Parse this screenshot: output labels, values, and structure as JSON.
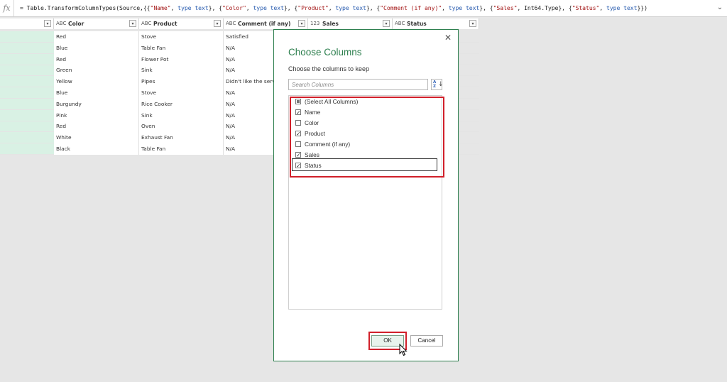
{
  "formula_bar": {
    "fx_label": "fx",
    "formula_prefix": "= Table.TransformColumnTypes(Source,{{",
    "formula_parts": [
      {
        "t": "st",
        "v": "\"Name\""
      },
      {
        "t": "p",
        "v": ", "
      },
      {
        "t": "kw",
        "v": "type text"
      },
      {
        "t": "p",
        "v": "}, {"
      },
      {
        "t": "st",
        "v": "\"Color\""
      },
      {
        "t": "p",
        "v": ", "
      },
      {
        "t": "kw",
        "v": "type text"
      },
      {
        "t": "p",
        "v": "}, {"
      },
      {
        "t": "st",
        "v": "\"Product\""
      },
      {
        "t": "p",
        "v": ", "
      },
      {
        "t": "kw",
        "v": "type text"
      },
      {
        "t": "p",
        "v": "}, {"
      },
      {
        "t": "st",
        "v": "\"Comment (if any)\""
      },
      {
        "t": "p",
        "v": ", "
      },
      {
        "t": "kw",
        "v": "type text"
      },
      {
        "t": "p",
        "v": "}, {"
      },
      {
        "t": "st",
        "v": "\"Sales\""
      },
      {
        "t": "p",
        "v": ", Int64.Type}, {"
      },
      {
        "t": "st",
        "v": "\"Status\""
      },
      {
        "t": "p",
        "v": ", "
      },
      {
        "t": "kw",
        "v": "type text"
      },
      {
        "t": "p",
        "v": "}})"
      }
    ],
    "expand_glyph": "⌄"
  },
  "grid": {
    "columns": [
      {
        "type": "",
        "label": ""
      },
      {
        "type": "ABC",
        "label": "Color"
      },
      {
        "type": "ABC",
        "label": "Product"
      },
      {
        "type": "ABC",
        "label": "Comment (if any)"
      },
      {
        "type": "123",
        "label": "Sales"
      },
      {
        "type": "ABC",
        "label": "Status"
      }
    ],
    "rows": [
      [
        "Red",
        "Stove",
        "Satisfied"
      ],
      [
        "Blue",
        "Table Fan",
        "N/A"
      ],
      [
        "Red",
        "Flower Pot",
        "N/A"
      ],
      [
        "Green",
        "Sink",
        "N/A"
      ],
      [
        "Yellow",
        "Pipes",
        "Didn't like the serv"
      ],
      [
        "Blue",
        "Stove",
        "N/A"
      ],
      [
        "Burgundy",
        "Rice Cooker",
        "N/A"
      ],
      [
        "Pink",
        "Sink",
        "N/A"
      ],
      [
        "Red",
        "Oven",
        "N/A"
      ],
      [
        "White",
        "Exhaust Fan",
        "N/A"
      ],
      [
        "Black",
        "Table Fan",
        "N/A"
      ]
    ]
  },
  "dialog": {
    "title": "Choose Columns",
    "subtitle": "Choose the columns to keep",
    "search_placeholder": "Search Columns",
    "sort_glyph_az": "A\nZ",
    "sort_glyph_arrow": "↓",
    "close_glyph": "✕",
    "options": [
      {
        "label": "(Select All Columns)",
        "state": "partial"
      },
      {
        "label": "Name",
        "state": "checked"
      },
      {
        "label": "Color",
        "state": "unchecked"
      },
      {
        "label": "Product",
        "state": "checked"
      },
      {
        "label": "Comment (if any)",
        "state": "unchecked"
      },
      {
        "label": "Sales",
        "state": "checked"
      },
      {
        "label": "Status",
        "state": "checked"
      }
    ],
    "ok_label": "OK",
    "cancel_label": "Cancel"
  },
  "colors": {
    "accent_green": "#2d7f4e",
    "header_underline": "#27b09f",
    "highlight_red": "#d1202a"
  }
}
